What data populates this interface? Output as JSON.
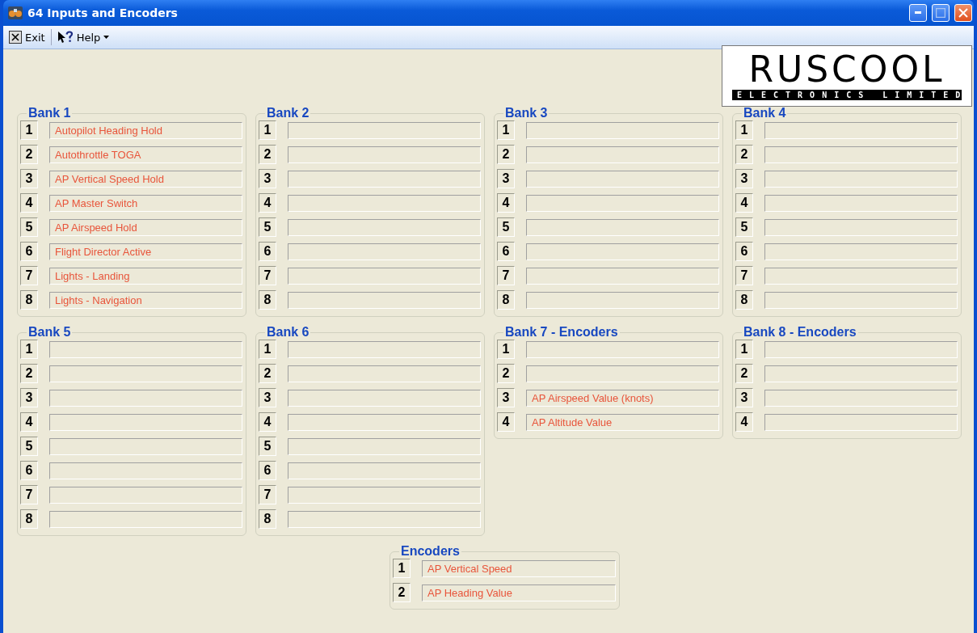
{
  "window": {
    "title": "64 Inputs and Encoders"
  },
  "toolbar": [
    {
      "label": "Exit",
      "kind": "exit"
    },
    {
      "label": "Help",
      "kind": "help"
    }
  ],
  "logo": {
    "name": "RUSCOOL",
    "tagline": "ELECTRONICS LIMITED"
  },
  "banks": [
    {
      "title": "Bank 1",
      "rows": [
        {
          "number": "1",
          "value": "Autopilot Heading Hold"
        },
        {
          "number": "2",
          "value": "Autothrottle TOGA"
        },
        {
          "number": "3",
          "value": "AP Vertical Speed Hold"
        },
        {
          "number": "4",
          "value": "AP Master Switch"
        },
        {
          "number": "5",
          "value": "AP Airspeed Hold"
        },
        {
          "number": "6",
          "value": "Flight Director Active"
        },
        {
          "number": "7",
          "value": "Lights - Landing"
        },
        {
          "number": "8",
          "value": "Lights - Navigation"
        }
      ]
    },
    {
      "title": "Bank 2",
      "rows": [
        {
          "number": "1"
        },
        {
          "number": "2"
        },
        {
          "number": "3"
        },
        {
          "number": "4"
        },
        {
          "number": "5"
        },
        {
          "number": "6"
        },
        {
          "number": "7"
        },
        {
          "number": "8"
        }
      ]
    },
    {
      "title": "Bank 3",
      "rows": [
        {
          "number": "1"
        },
        {
          "number": "2"
        },
        {
          "number": "3"
        },
        {
          "number": "4"
        },
        {
          "number": "5"
        },
        {
          "number": "6"
        },
        {
          "number": "7"
        },
        {
          "number": "8"
        }
      ]
    },
    {
      "title": "Bank 4",
      "rows": [
        {
          "number": "1"
        },
        {
          "number": "2"
        },
        {
          "number": "3"
        },
        {
          "number": "4"
        },
        {
          "number": "5"
        },
        {
          "number": "6"
        },
        {
          "number": "7"
        },
        {
          "number": "8"
        }
      ]
    },
    {
      "title": "Bank 5",
      "rows": [
        {
          "number": "1"
        },
        {
          "number": "2"
        },
        {
          "number": "3"
        },
        {
          "number": "4"
        },
        {
          "number": "5"
        },
        {
          "number": "6"
        },
        {
          "number": "7"
        },
        {
          "number": "8"
        }
      ]
    },
    {
      "title": "Bank 6",
      "rows": [
        {
          "number": "1"
        },
        {
          "number": "2"
        },
        {
          "number": "3"
        },
        {
          "number": "4"
        },
        {
          "number": "5"
        },
        {
          "number": "6"
        },
        {
          "number": "7"
        },
        {
          "number": "8"
        }
      ]
    },
    {
      "title": "Bank 7 - Encoders",
      "rows": [
        {
          "number": "1"
        },
        {
          "number": "2"
        },
        {
          "number": "3",
          "value": "AP Airspeed Value (knots)"
        },
        {
          "number": "4",
          "value": "AP Altitude Value"
        }
      ]
    },
    {
      "title": "Bank 8 - Encoders",
      "rows": [
        {
          "number": "1"
        },
        {
          "number": "2"
        },
        {
          "number": "3"
        },
        {
          "number": "4"
        }
      ]
    }
  ],
  "encoders": {
    "title": "Encoders",
    "rows": [
      {
        "number": "1",
        "value": "AP Vertical Speed"
      },
      {
        "number": "2",
        "value": "AP Heading Value"
      }
    ]
  }
}
